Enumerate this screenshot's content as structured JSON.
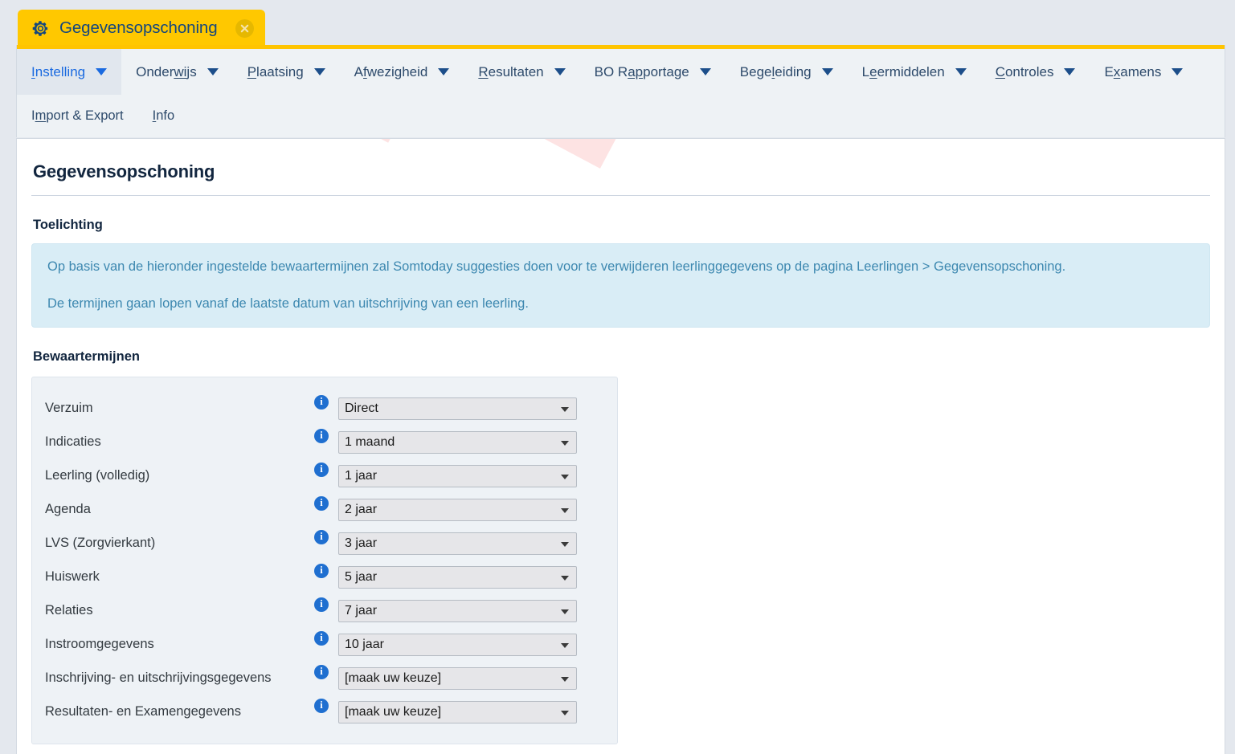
{
  "tab": {
    "icon": "gear-icon",
    "title": "Gegevensopschoning",
    "close_icon": "close-icon"
  },
  "nav": {
    "primary": [
      {
        "label": "Instelling",
        "mnemonic": "I",
        "active": true,
        "caret": true
      },
      {
        "label": "Onderwijs",
        "mnemonic": "wi",
        "active": false,
        "caret": true
      },
      {
        "label": "Plaatsing",
        "mnemonic": "P",
        "active": false,
        "caret": true
      },
      {
        "label": "Afwezigheid",
        "mnemonic": "f",
        "active": false,
        "caret": true
      },
      {
        "label": "Resultaten",
        "mnemonic": "R",
        "active": false,
        "caret": true
      },
      {
        "label": "BO Rapportage",
        "mnemonic": "ap",
        "active": false,
        "caret": true
      },
      {
        "label": "Begeleiding",
        "mnemonic": "l",
        "active": false,
        "caret": true
      },
      {
        "label": "Leermiddelen",
        "mnemonic": "e",
        "active": false,
        "caret": true
      },
      {
        "label": "Controles",
        "mnemonic": "C",
        "active": false,
        "caret": true
      },
      {
        "label": "Examens",
        "mnemonic": "x",
        "active": false,
        "caret": true
      }
    ],
    "secondary": [
      {
        "label": "Import & Export",
        "mnemonic": "m"
      },
      {
        "label": "Info",
        "mnemonic": "I"
      }
    ]
  },
  "page": {
    "title": "Gegevensopschoning",
    "explanation_heading": "Toelichting",
    "explanation_lines": [
      "Op basis van de hieronder ingestelde bewaartermijnen zal Somtoday suggesties doen voor te verwijderen leerlinggegevens op de pagina Leerlingen > Gegevensopschoning.",
      "De termijnen gaan lopen vanaf de laatste datum van uitschrijving van een leerling."
    ],
    "retention_heading": "Bewaartermijnen",
    "watermark": "TEST"
  },
  "retention_rows": [
    {
      "label": "Verzuim",
      "value": "Direct",
      "info": "info-icon"
    },
    {
      "label": "Indicaties",
      "value": "1 maand",
      "info": "info-icon"
    },
    {
      "label": "Leerling (volledig)",
      "value": "1 jaar",
      "info": "info-icon"
    },
    {
      "label": "Agenda",
      "value": "2 jaar",
      "info": "info-icon"
    },
    {
      "label": "LVS (Zorgvierkant)",
      "value": "3 jaar",
      "info": "info-icon"
    },
    {
      "label": "Huiswerk",
      "value": "5 jaar",
      "info": "info-icon"
    },
    {
      "label": "Relaties",
      "value": "7 jaar",
      "info": "info-icon"
    },
    {
      "label": "Instroomgegevens",
      "value": "10 jaar",
      "info": "info-icon"
    },
    {
      "label": "Inschrijving- en uitschrijvingsgegevens",
      "value": "[maak uw keuze]",
      "info": "info-icon"
    },
    {
      "label": "Resultaten- en Examengegevens",
      "value": "[maak uw keuze]",
      "info": "info-icon"
    }
  ],
  "colors": {
    "tab_yellow": "#ffc800",
    "nav_accent": "#ffc400",
    "active_link": "#1a6ae0",
    "nav_text": "#2d4a6b",
    "info_box_bg": "#d9edf6",
    "info_box_text": "#3d88b0",
    "info_icon_blue": "#1f6fd0",
    "watermark_pink": "#fde3e3"
  }
}
